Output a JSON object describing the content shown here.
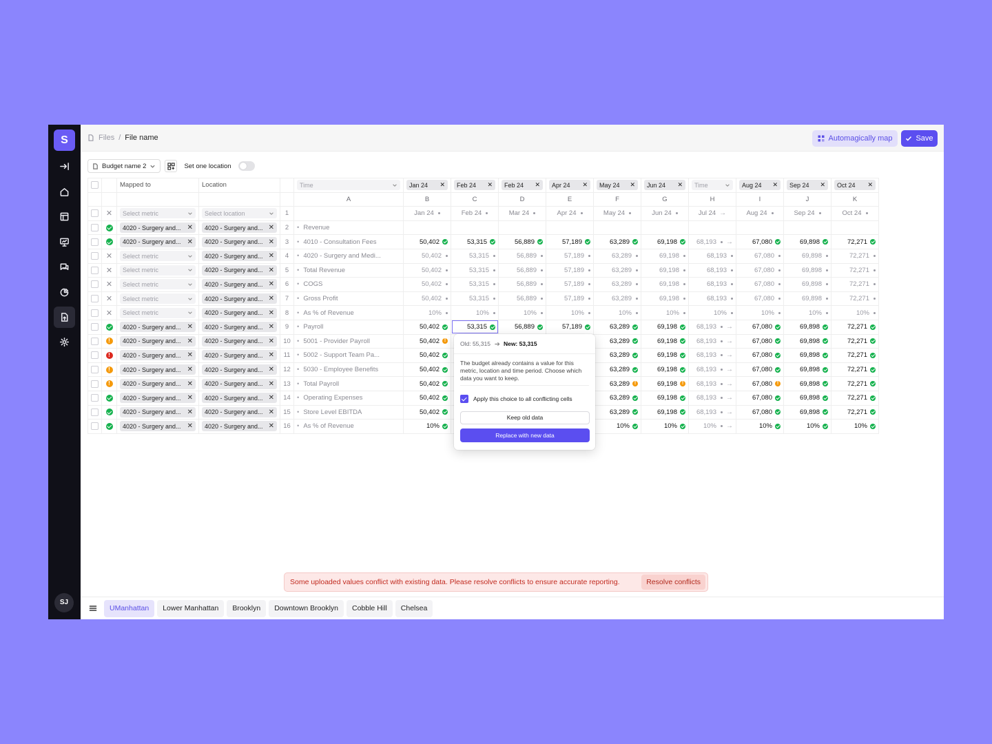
{
  "app": {
    "logo_letter": "S",
    "user_initials": "SJ",
    "sidebar_icons": [
      "collapse-icon",
      "home-icon",
      "table-icon",
      "presentation-icon",
      "chat-icon",
      "pie-chart-icon",
      "file-upload-icon",
      "gear-icon"
    ],
    "active_sidebar_index": 6
  },
  "breadcrumb": {
    "root": "Files",
    "separator": "/",
    "current": "File name"
  },
  "actions": {
    "auto_map": "Automagically map",
    "save": "Save"
  },
  "toolbar": {
    "budget": "Budget name 2",
    "location_toggle_label": "Set one location",
    "location_toggle_on": false
  },
  "table": {
    "header_mapped": "Mapped to",
    "header_location": "Location",
    "time_placeholder": "Time",
    "time_chips": [
      "Jan 24",
      "Feb 24",
      "Feb 24",
      "Apr 24",
      "May 24",
      "Jun 24",
      "",
      "Aug 24",
      "Sep 24",
      "Oct 24"
    ],
    "column_letters": [
      "A",
      "B",
      "C",
      "D",
      "E",
      "F",
      "G",
      "H",
      "I",
      "J",
      "K"
    ],
    "date_row": [
      "Jan 24",
      "Feb 24",
      "Mar 24",
      "Apr 24",
      "May 24",
      "Jun 24",
      "Jul 24",
      "Aug 24",
      "Sep 24",
      "Oct 24"
    ],
    "select_metric": "Select metric",
    "select_location": "Select location",
    "metric_chip": "4020 - Surgery and...",
    "location_chip": "4020 - Surgery and...",
    "rows": [
      {
        "n": "2",
        "status": "ok",
        "metric": true,
        "location": true,
        "name": "Revenue",
        "values": null
      },
      {
        "n": "3",
        "status": "ok",
        "metric": true,
        "location": true,
        "name": "4010 - Consultation Fees",
        "values": [
          "50,402",
          "53,315",
          "56,889",
          "57,189",
          "63,289",
          "69,198",
          "68,193",
          "67,080",
          "69,898",
          "72,271"
        ],
        "flags": [
          "ok",
          "ok",
          "ok",
          "ok",
          "ok",
          "ok",
          "skip",
          "ok",
          "ok",
          "ok"
        ]
      },
      {
        "n": "4",
        "status": "x",
        "metric": false,
        "location": true,
        "name": "4020 - Surgery and Medi...",
        "values": [
          "50,402",
          "53,315",
          "56,889",
          "57,189",
          "63,289",
          "69,198",
          "68,193",
          "67,080",
          "69,898",
          "72,271"
        ],
        "flags": [
          "dim",
          "dim",
          "dim",
          "dim",
          "dim",
          "dim",
          "dim",
          "dim",
          "dim",
          "dim"
        ]
      },
      {
        "n": "5",
        "status": "x",
        "metric": false,
        "location": true,
        "name": "Total Revenue",
        "values": [
          "50,402",
          "53,315",
          "56,889",
          "57,189",
          "63,289",
          "69,198",
          "68,193",
          "67,080",
          "69,898",
          "72,271"
        ],
        "flags": [
          "dim",
          "dim",
          "dim",
          "dim",
          "dim",
          "dim",
          "dim",
          "dim",
          "dim",
          "dim"
        ]
      },
      {
        "n": "6",
        "status": "x",
        "metric": false,
        "location": true,
        "name": "COGS",
        "values": [
          "50,402",
          "53,315",
          "56,889",
          "57,189",
          "63,289",
          "69,198",
          "68,193",
          "67,080",
          "69,898",
          "72,271"
        ],
        "flags": [
          "dim",
          "dim",
          "dim",
          "dim",
          "dim",
          "dim",
          "dim",
          "dim",
          "dim",
          "dim"
        ]
      },
      {
        "n": "7",
        "status": "x",
        "metric": false,
        "location": true,
        "name": "Gross Profit",
        "values": [
          "50,402",
          "53,315",
          "56,889",
          "57,189",
          "63,289",
          "69,198",
          "68,193",
          "67,080",
          "69,898",
          "72,271"
        ],
        "flags": [
          "dim",
          "dim",
          "dim",
          "dim",
          "dim",
          "dim",
          "dim",
          "dim",
          "dim",
          "dim"
        ]
      },
      {
        "n": "8",
        "status": "x",
        "metric": false,
        "location": true,
        "name": "As % of Revenue",
        "values": [
          "10%",
          "10%",
          "10%",
          "10%",
          "10%",
          "10%",
          "10%",
          "10%",
          "10%",
          "10%"
        ],
        "flags": [
          "dim",
          "dim",
          "dim",
          "dim",
          "dim",
          "dim",
          "dim",
          "dim",
          "dim",
          "dim"
        ]
      },
      {
        "n": "9",
        "status": "ok",
        "metric": true,
        "location": true,
        "name": "Payroll",
        "values": [
          "50,402",
          "53,315",
          "56,889",
          "57,189",
          "63,289",
          "69,198",
          "68,193",
          "67,080",
          "69,898",
          "72,271"
        ],
        "flags": [
          "ok",
          "ok",
          "ok",
          "ok",
          "ok",
          "ok",
          "skip",
          "ok",
          "ok",
          "ok"
        ]
      },
      {
        "n": "10",
        "status": "warn",
        "metric": true,
        "location": true,
        "name": "5001 - Provider Payroll",
        "values": [
          "50,402",
          "",
          "",
          "",
          "63,289",
          "69,198",
          "68,193",
          "67,080",
          "69,898",
          "72,271"
        ],
        "flags": [
          "warn",
          "",
          "",
          "",
          "ok",
          "ok",
          "skip",
          "ok",
          "ok",
          "ok"
        ]
      },
      {
        "n": "11",
        "status": "err",
        "metric": true,
        "location": true,
        "name": "5002 - Support Team Pa...",
        "values": [
          "50,402",
          "",
          "",
          "",
          "63,289",
          "69,198",
          "68,193",
          "67,080",
          "69,898",
          "72,271"
        ],
        "flags": [
          "ok",
          "",
          "",
          "",
          "ok",
          "ok",
          "skip",
          "ok",
          "ok",
          "ok"
        ]
      },
      {
        "n": "12",
        "status": "warn",
        "metric": true,
        "location": true,
        "name": "5030 - Employee Benefits",
        "values": [
          "50,402",
          "",
          "",
          "",
          "63,289",
          "69,198",
          "68,193",
          "67,080",
          "69,898",
          "72,271"
        ],
        "flags": [
          "ok",
          "",
          "",
          "",
          "ok",
          "ok",
          "skip",
          "ok",
          "ok",
          "ok"
        ]
      },
      {
        "n": "13",
        "status": "warn",
        "metric": true,
        "location": true,
        "name": "Total Payroll",
        "values": [
          "50,402",
          "",
          "",
          "",
          "63,289",
          "69,198",
          "68,193",
          "67,080",
          "69,898",
          "72,271"
        ],
        "flags": [
          "ok",
          "",
          "",
          "",
          "warn",
          "warn",
          "skip",
          "warn",
          "ok",
          "ok"
        ]
      },
      {
        "n": "14",
        "status": "ok",
        "metric": true,
        "location": true,
        "name": "Operating Expenses",
        "values": [
          "50,402",
          "",
          "",
          "",
          "63,289",
          "69,198",
          "68,193",
          "67,080",
          "69,898",
          "72,271"
        ],
        "flags": [
          "ok",
          "",
          "",
          "",
          "ok",
          "ok",
          "skip",
          "ok",
          "ok",
          "ok"
        ]
      },
      {
        "n": "15",
        "status": "ok",
        "metric": true,
        "location": true,
        "name": "Store Level EBITDA",
        "values": [
          "50,402",
          "",
          "",
          "",
          "63,289",
          "69,198",
          "68,193",
          "67,080",
          "69,898",
          "72,271"
        ],
        "flags": [
          "ok",
          "",
          "",
          "",
          "ok",
          "ok",
          "skip",
          "ok",
          "ok",
          "ok"
        ]
      },
      {
        "n": "16",
        "status": "ok",
        "metric": true,
        "location": true,
        "name": "As % of Revenue",
        "values": [
          "10%",
          "",
          "",
          "",
          "10%",
          "10%",
          "10%",
          "10%",
          "10%",
          "10%"
        ],
        "flags": [
          "ok",
          "",
          "",
          "",
          "ok",
          "ok",
          "skip",
          "ok",
          "ok",
          "ok"
        ]
      }
    ]
  },
  "popover": {
    "old_label": "Old: 55,315",
    "new_label": "New: 53,315",
    "message": "The budget already contains a value for this metric, location and time period. Choose which data you want to keep.",
    "apply_all": "Apply this choice to all conflicting cells",
    "keep_old": "Keep old data",
    "replace_new": "Replace with new data"
  },
  "banner": {
    "message": "Some uploaded values conflict with existing data. Please resolve conflicts to ensure accurate reporting.",
    "action": "Resolve conflicts"
  },
  "tabs": [
    "UManhattan",
    "Lower Manhattan",
    "Brooklyn",
    "Downtown Brooklyn",
    "Cobble Hill",
    "Chelsea"
  ],
  "active_tab_index": 0,
  "colors": {
    "accent": "#5b4ef0",
    "background": "#8b85fd",
    "ok": "#16b24e",
    "warn": "#f59a0c",
    "error": "#dd2a20"
  }
}
